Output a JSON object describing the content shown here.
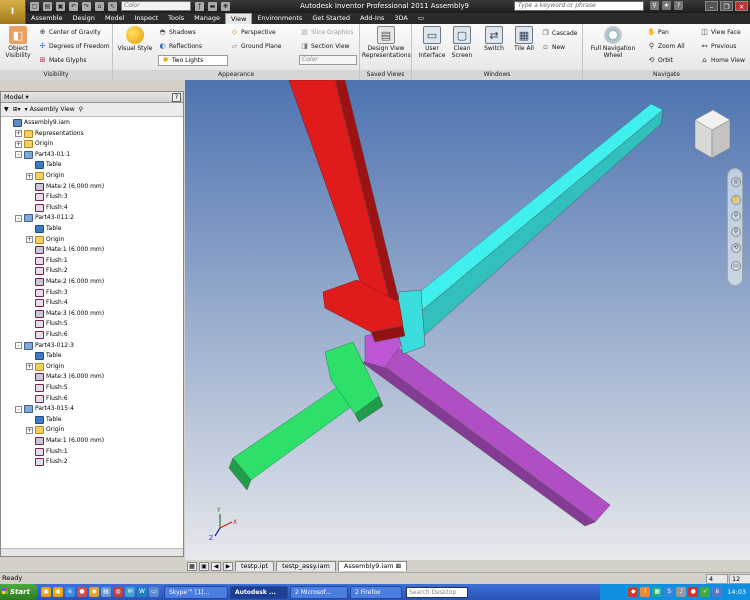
{
  "titlebar": {
    "app_button": "I",
    "color_select": "Color",
    "window_title": "Autodesk Inventor Professional 2011    Assembly9",
    "search_placeholder": "Type a keyword or phrase"
  },
  "ribbon_tabs": [
    "Assemble",
    "Design",
    "Model",
    "Inspect",
    "Tools",
    "Manage",
    "View",
    "Environments",
    "Get Started",
    "Add-Ins",
    "3DA"
  ],
  "active_tab": "View",
  "ribbon": {
    "visibility": {
      "label": "Visibility",
      "object_visibility": "Object Visibility",
      "center_of_gravity": "Center of Gravity",
      "degrees_of_freedom": "Degrees of Freedom",
      "mate_glyphs": "Mate Glyphs"
    },
    "appearance": {
      "label": "Appearance",
      "visual_style": "Visual Style",
      "shadows": "Shadows",
      "reflections": "Reflections",
      "two_lights": "Two Lights",
      "perspective": "Perspective",
      "ground_plane": "Ground Plane",
      "slice_graphics": "Slice Graphics",
      "section_view": "Section View",
      "color": "Color"
    },
    "saved_views": {
      "label": "Saved Views",
      "design_view_representations": "Design View Representations"
    },
    "windows": {
      "label": "Windows",
      "user_interface": "User Interface",
      "clean_screen": "Clean Screen",
      "switch": "Switch",
      "tile_all": "Tile All",
      "cascade": "Cascade",
      "new": "New"
    },
    "navigate": {
      "label": "Navigate",
      "full_navigation_wheel": "Full Navigation Wheel",
      "pan": "Pan",
      "zoom_all": "Zoom All",
      "orbit": "Orbit",
      "view_face": "View Face",
      "previous": "Previous",
      "home_view": "Home View"
    }
  },
  "browser": {
    "title": "Model",
    "help": "?",
    "view_select": "Assembly View",
    "tree": [
      {
        "label": "Assembly9.iam",
        "icon": "assembly-icon",
        "depth": 0,
        "expand": ""
      },
      {
        "label": "Representations",
        "icon": "folder-icon",
        "depth": 1,
        "expand": "+"
      },
      {
        "label": "Origin",
        "icon": "folder-icon",
        "depth": 1,
        "expand": "+"
      },
      {
        "label": "Part43-01:1",
        "icon": "part-icon",
        "depth": 1,
        "expand": "-"
      },
      {
        "label": "Table",
        "icon": "table-icon",
        "depth": 2,
        "expand": ""
      },
      {
        "label": "Origin",
        "icon": "folder-icon",
        "depth": 2,
        "expand": "+"
      },
      {
        "label": "Mate:2 (6.000 mm)",
        "icon": "mate-icon",
        "depth": 2,
        "expand": ""
      },
      {
        "label": "Flush:3",
        "icon": "flush-icon",
        "depth": 2,
        "expand": ""
      },
      {
        "label": "Flush:4",
        "icon": "flush-icon",
        "depth": 2,
        "expand": ""
      },
      {
        "label": "Part43-011:2",
        "icon": "part-icon",
        "depth": 1,
        "expand": "-"
      },
      {
        "label": "Table",
        "icon": "table-icon",
        "depth": 2,
        "expand": ""
      },
      {
        "label": "Origin",
        "icon": "folder-icon",
        "depth": 2,
        "expand": "+"
      },
      {
        "label": "Mate:1 (6.000 mm)",
        "icon": "mate-icon",
        "depth": 2,
        "expand": ""
      },
      {
        "label": "Flush:1",
        "icon": "flush-icon",
        "depth": 2,
        "expand": ""
      },
      {
        "label": "Flush:2",
        "icon": "flush-icon",
        "depth": 2,
        "expand": ""
      },
      {
        "label": "Mate:2 (6.000 mm)",
        "icon": "mate-icon",
        "depth": 2,
        "expand": ""
      },
      {
        "label": "Flush:3",
        "icon": "flush-icon",
        "depth": 2,
        "expand": ""
      },
      {
        "label": "Flush:4",
        "icon": "flush-icon",
        "depth": 2,
        "expand": ""
      },
      {
        "label": "Mate:3 (6.000 mm)",
        "icon": "mate-icon",
        "depth": 2,
        "expand": ""
      },
      {
        "label": "Flush:5",
        "icon": "flush-icon",
        "depth": 2,
        "expand": ""
      },
      {
        "label": "Flush:6",
        "icon": "flush-icon",
        "depth": 2,
        "expand": ""
      },
      {
        "label": "Part43-012:3",
        "icon": "part-icon",
        "depth": 1,
        "expand": "-"
      },
      {
        "label": "Table",
        "icon": "table-icon",
        "depth": 2,
        "expand": ""
      },
      {
        "label": "Origin",
        "icon": "folder-icon",
        "depth": 2,
        "expand": "+"
      },
      {
        "label": "Mate:3 (6.000 mm)",
        "icon": "mate-icon",
        "depth": 2,
        "expand": ""
      },
      {
        "label": "Flush:5",
        "icon": "flush-icon",
        "depth": 2,
        "expand": ""
      },
      {
        "label": "Flush:6",
        "icon": "flush-icon",
        "depth": 2,
        "expand": ""
      },
      {
        "label": "Part43-015:4",
        "icon": "part-icon",
        "depth": 1,
        "expand": "-"
      },
      {
        "label": "Table",
        "icon": "table-icon",
        "depth": 2,
        "expand": ""
      },
      {
        "label": "Origin",
        "icon": "folder-icon",
        "depth": 2,
        "expand": "+"
      },
      {
        "label": "Mate:1 (6.000 mm)",
        "icon": "mate-icon",
        "depth": 2,
        "expand": ""
      },
      {
        "label": "Flush:1",
        "icon": "flush-icon",
        "depth": 2,
        "expand": ""
      },
      {
        "label": "Flush:2",
        "icon": "flush-icon",
        "depth": 2,
        "expand": ""
      }
    ]
  },
  "viewport": {
    "background_top": "#4d73b0",
    "background_bottom": "#e6e8ec",
    "parts": {
      "red": "#e01b1b",
      "cyan": "#3ff0ef",
      "green": "#2ee06a",
      "purple": "#b04fc4"
    },
    "triad": {
      "x": "X",
      "y": "Y",
      "z": "Z"
    }
  },
  "doc_tabs": [
    "testp.ipt",
    "testp_assy.iam",
    "Assembly9.iam"
  ],
  "active_doc": "Assembly9.iam",
  "status": {
    "text": "Ready",
    "num1": "4",
    "num2": "12"
  },
  "taskbar": {
    "start": "Start",
    "items": [
      "Skype™ [1]...",
      "Autodesk ...",
      "2 Microsof...",
      "2 Firefox"
    ],
    "search_placeholder": "Search Desktop",
    "clock": "14:03"
  }
}
